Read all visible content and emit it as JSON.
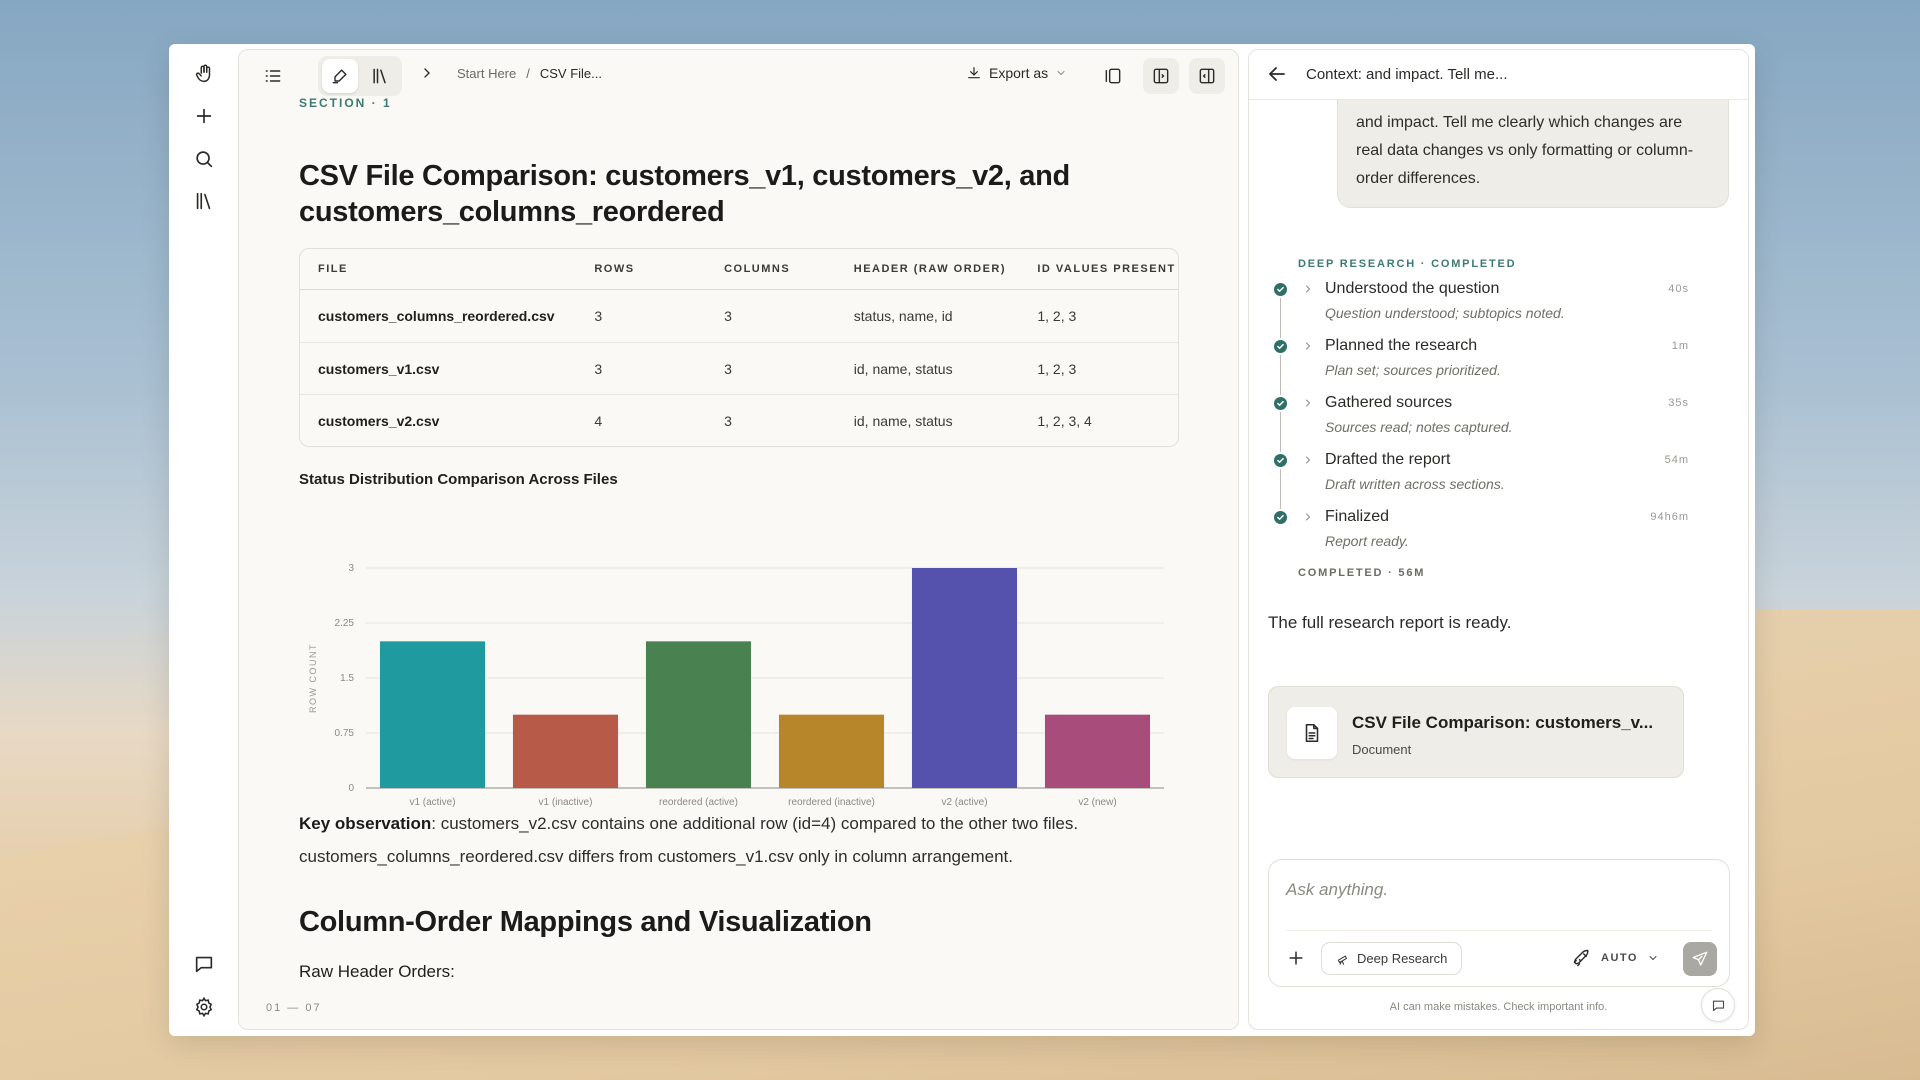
{
  "doc": {
    "breadcrumb": {
      "root": "Start Here",
      "separator": "/",
      "current": "CSV File..."
    },
    "export_label": "Export as",
    "section_label": "SECTION · 1",
    "title": "CSV File Comparison: customers_v1, customers_v2, and customers_columns_reordered",
    "table": {
      "headers": [
        "FILE",
        "ROWS",
        "COLUMNS",
        "HEADER (RAW ORDER)",
        "ID VALUES PRESENT"
      ],
      "rows": [
        [
          "customers_columns_reordered.csv",
          "3",
          "3",
          "status, name, id",
          "1, 2, 3"
        ],
        [
          "customers_v1.csv",
          "3",
          "3",
          "id, name, status",
          "1, 2, 3"
        ],
        [
          "customers_v2.csv",
          "4",
          "3",
          "id, name, status",
          "1, 2, 3, 4"
        ]
      ]
    },
    "chart_title": "Status Distribution Comparison Across Files",
    "key_observation_label": "Key observation",
    "key_observation_text": ": customers_v2.csv contains one additional row (id=4) compared to the other two files. customers_columns_reordered.csv differs from customers_v1.csv only in column arrangement.",
    "h2": "Column-Order Mappings and Visualization",
    "h3": "Raw Header Orders:",
    "pager": "01 — 07"
  },
  "chart_data": {
    "type": "bar",
    "title": "Status Distribution Comparison Across Files",
    "xlabel": "",
    "ylabel": "ROW COUNT",
    "categories": [
      "v1 (active)",
      "v1 (inactive)",
      "reordered (active)",
      "reordered (inactive)",
      "v2 (active)",
      "v2 (new)"
    ],
    "values": [
      2,
      1,
      2,
      1,
      3,
      1
    ],
    "colors": [
      "#1f9a9e",
      "#b85a48",
      "#4a8150",
      "#b8862a",
      "#5552ad",
      "#a84c7c"
    ],
    "ylim": [
      0,
      3
    ],
    "yticks": [
      "0",
      "0.75",
      "1.5",
      "2.25",
      "3"
    ],
    "grid": true
  },
  "chat": {
    "header_title": "Context: and impact. Tell me...",
    "user_message": "and impact. Tell me clearly which changes are real data changes vs only formatting or column-order differences.",
    "research_label": "DEEP RESEARCH · COMPLETED",
    "steps": [
      {
        "title": "Understood the question",
        "sub": "Question understood; subtopics noted.",
        "time": "40s"
      },
      {
        "title": "Planned the research",
        "sub": "Plan set; sources prioritized.",
        "time": "1m"
      },
      {
        "title": "Gathered sources",
        "sub": "Sources read; notes captured.",
        "time": "35s"
      },
      {
        "title": "Drafted the report",
        "sub": "Draft written across sections.",
        "time": "54m"
      },
      {
        "title": "Finalized",
        "sub": "Report ready.",
        "time": "94h6m"
      }
    ],
    "completed_label": "COMPLETED · 56M",
    "ready_message": "The full research report is ready.",
    "doc_card": {
      "name": "CSV File Comparison: customers_v...",
      "type": "Document"
    },
    "composer": {
      "placeholder": "Ask anything.",
      "deep_research_label": "Deep Research",
      "mode_label": "AUTO"
    },
    "disclaimer": "AI can make mistakes. Check important info."
  },
  "colors": {
    "accent_teal": "#3d7a72",
    "step_dot": "#2f6f67",
    "panel_bg": "#faf9f6"
  }
}
